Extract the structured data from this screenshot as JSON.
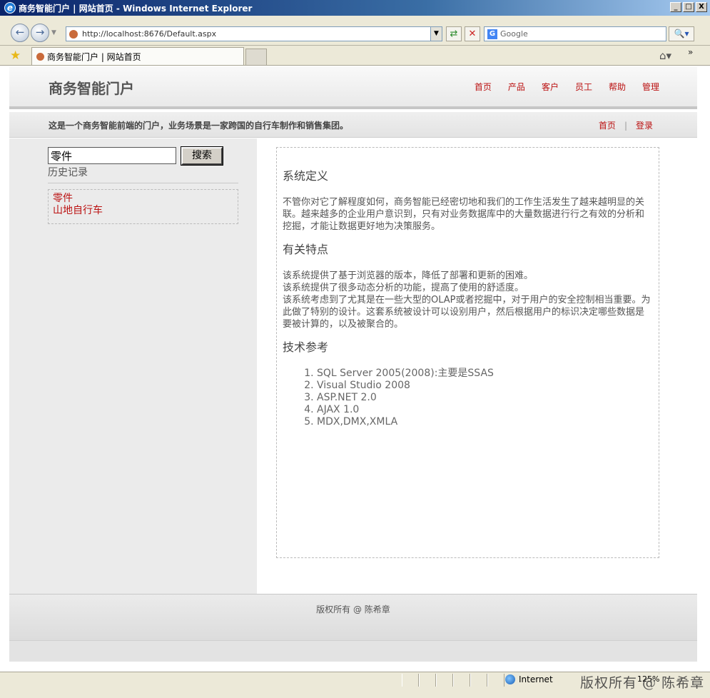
{
  "window": {
    "title": "商务智能门户 | 网站首页 - Windows Internet Explorer",
    "minimize": "_",
    "maximize": "□",
    "close": "X"
  },
  "toolbar": {
    "address": "http://localhost:8676/Default.aspx",
    "search_placeholder": "Google",
    "back_icon": "back-arrow-icon",
    "forward_icon": "forward-arrow-icon"
  },
  "tabs": {
    "active": "商务智能门户 | 网站首页"
  },
  "site": {
    "title": "商务智能门户",
    "nav": [
      "首页",
      "产品",
      "客户",
      "员工",
      "帮助",
      "管理"
    ],
    "tagline": "这是一个商务智能前端的门户，业务场景是一家跨国的自行车制作和销售集团。",
    "subnav": {
      "home": "首页",
      "sep": "|",
      "login": "登录"
    }
  },
  "sidebar": {
    "search_value": "零件",
    "search_button": "搜索",
    "history_label": "历史记录",
    "history_items": [
      "零件",
      "山地自行车"
    ]
  },
  "content": {
    "section1_title": "系统定义",
    "section1_text": "不管你对它了解程度如何，商务智能已经密切地和我们的工作生活发生了越来越明显的关联。越来越多的企业用户意识到，只有对业务数据库中的大量数据进行行之有效的分析和挖掘，才能让数据更好地为决策服务。",
    "section2_title": "有关特点",
    "section2_lines": [
      "该系统提供了基于浏览器的版本，降低了部署和更新的困难。",
      "该系统提供了很多动态分析的功能，提高了使用的舒适度。",
      "该系统考虑到了尤其是在一些大型的OLAP或者挖掘中，对于用户的安全控制相当重要。为此做了特别的设计。这套系统被设计可以设别用户，然后根据用户的标识决定哪些数据是要被计算的，以及被聚合的。"
    ],
    "section3_title": "技术参考",
    "references": [
      "SQL Server 2005(2008):主要是SSAS",
      "Visual Studio 2008",
      "ASP.NET 2.0",
      "AJAX 1.0",
      "MDX,DMX,XMLA"
    ]
  },
  "footer": {
    "copyright": "版权所有 @ 陈希章"
  },
  "status": {
    "zone": "Internet",
    "zoom": "125%",
    "watermark": "版权所有 @ 陈希章"
  }
}
